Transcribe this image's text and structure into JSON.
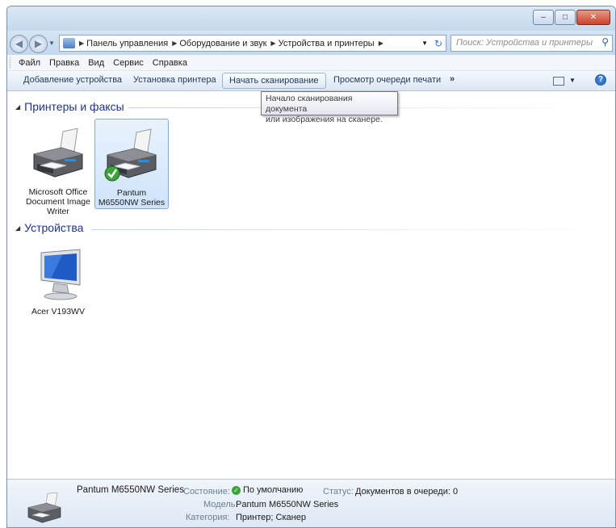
{
  "window": {
    "caption_buttons": [
      "–",
      "□",
      "✕"
    ]
  },
  "address": {
    "crumbs": [
      "Панель управления",
      "Оборудование и звук",
      "Устройства и принтеры"
    ],
    "search_placeholder": "Поиск: Устройства и принтеры"
  },
  "menu": {
    "items": [
      "Файл",
      "Правка",
      "Вид",
      "Сервис",
      "Справка"
    ]
  },
  "toolbar": {
    "add_device": "Добавление устройства",
    "install_printer": "Установка принтера",
    "start_scan": "Начать сканирование",
    "print_queue": "Просмотр очереди печати",
    "more": "»"
  },
  "tooltip": {
    "line1": "Начало сканирования документа",
    "line2": "или изображения на сканере."
  },
  "groups": {
    "printers": {
      "title": "Принтеры и факсы",
      "items": [
        {
          "name": "Microsoft Office Document Image Writer",
          "line1": "Microsoft Office",
          "line2": "Document Image",
          "line3": "Writer"
        },
        {
          "name": "Pantum M6550NW Series",
          "line1": "Pantum",
          "line2": "M6550NW Series",
          "default": true
        }
      ]
    },
    "devices": {
      "title": "Устройства",
      "items": [
        {
          "name": "Acer V193WV",
          "line1": "Acer V193WV"
        }
      ]
    }
  },
  "details": {
    "name": "Pantum M6550NW Series",
    "state_label": "Состояние:",
    "state_value": "По умолчанию",
    "status_label": "Статус:",
    "status_value": "Документов в очереди: 0",
    "model_label": "Модель:",
    "model_value": "Pantum M6550NW Series",
    "category_label": "Категория:",
    "category_value": "Принтер; Сканер"
  },
  "colors": {
    "group_title": "#1e3287",
    "selection": "#cfe3fb",
    "accent": "#3aa33a"
  }
}
